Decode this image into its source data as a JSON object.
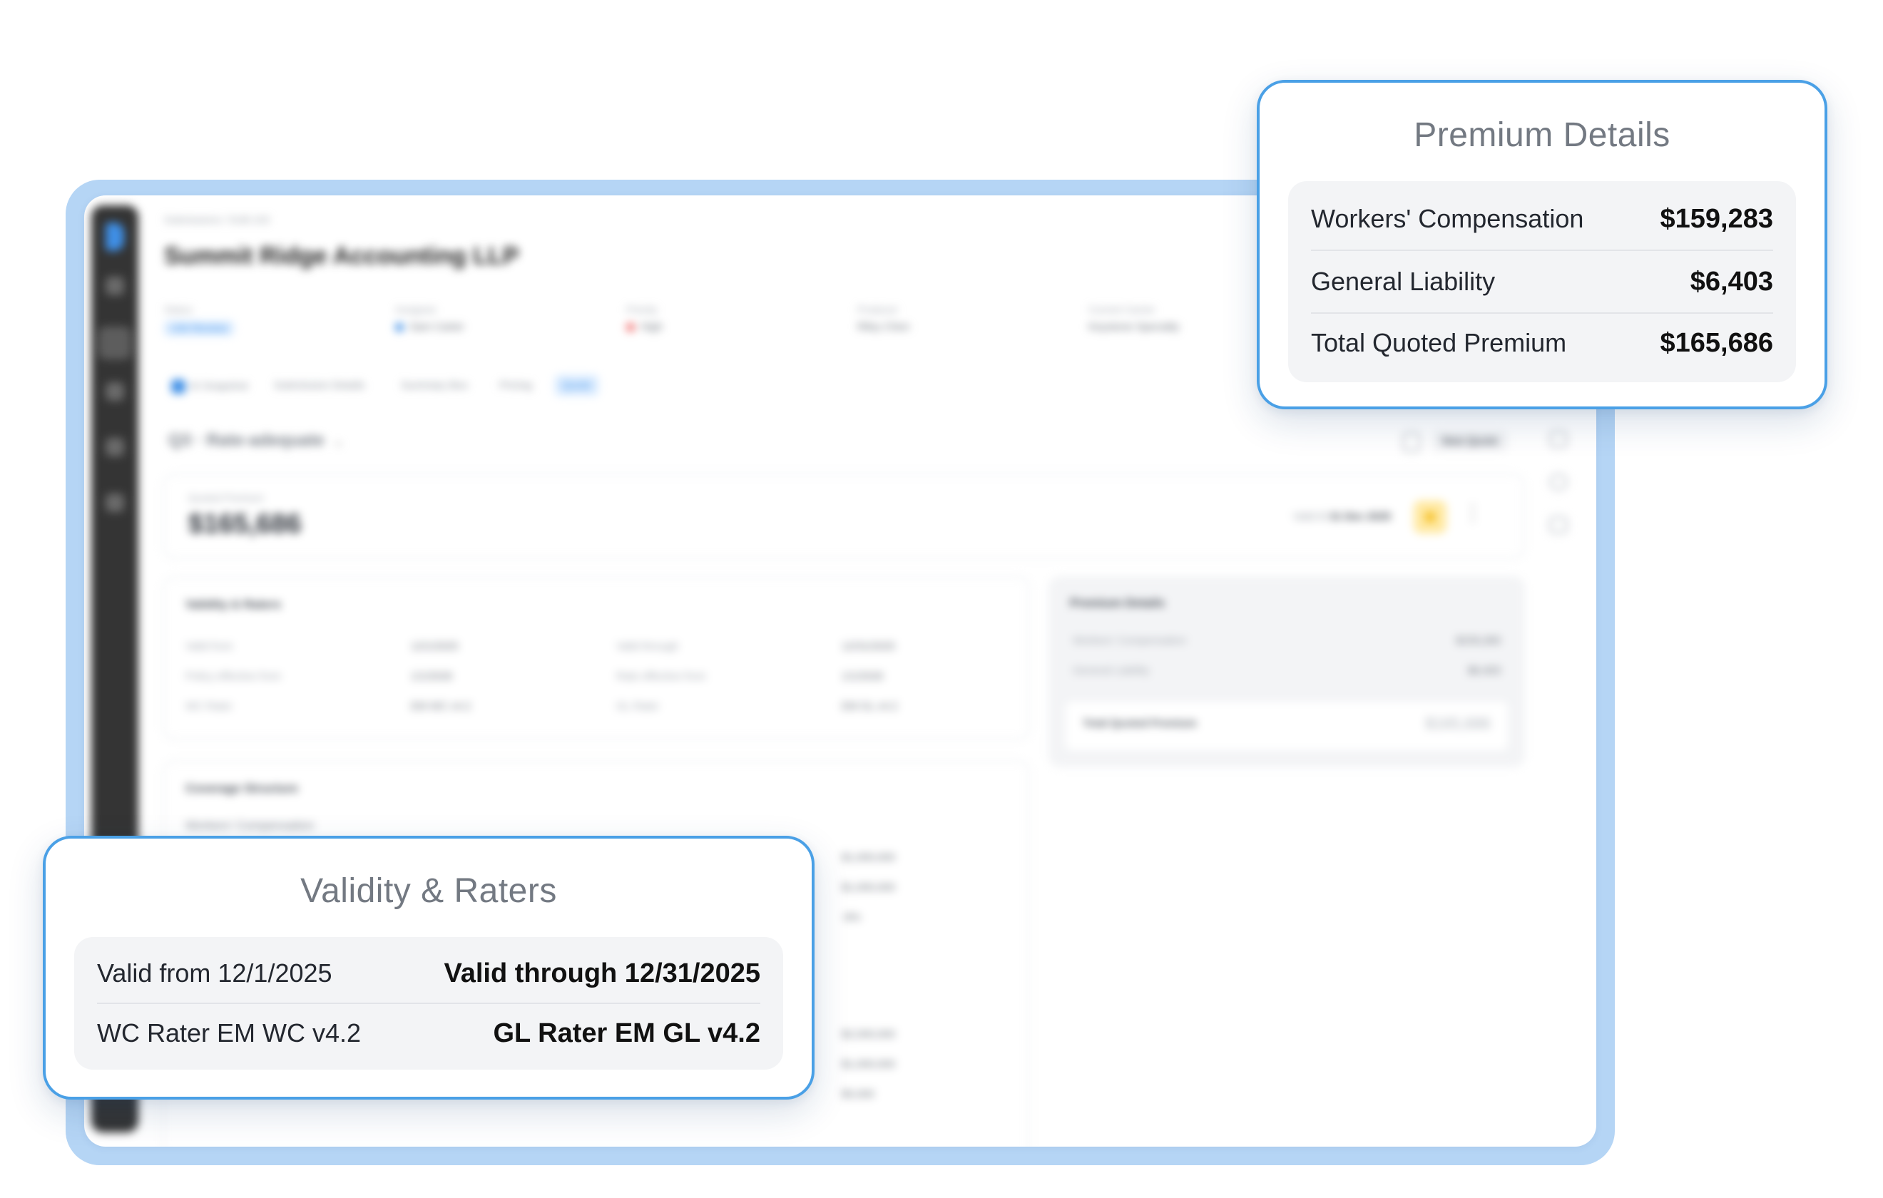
{
  "app": {
    "breadcrumb": "Submissions / SUB-103",
    "company_name": "Summit Ridge Accounting LLP",
    "meta": [
      {
        "label": "Status",
        "value": "UW Review"
      },
      {
        "label": "Assignee",
        "value": "Sam Carter"
      },
      {
        "label": "Priority",
        "value": "High"
      },
      {
        "label": "Producer",
        "value": "Riley Chen"
      },
      {
        "label": "Current Carrier",
        "value": "Keystone Specialty"
      }
    ],
    "tabs": [
      "AI Snapshot",
      "Submission Details",
      "Summary Box",
      "Pricing",
      "Quote"
    ],
    "active_tab": "Quote",
    "quote_selector": "Q3 · Rate-adequate",
    "new_quote_label": "New Quote",
    "quoted_premium": {
      "label": "Quoted Premium",
      "value": "$165,686",
      "valid_label": "Valid til",
      "valid_date": "31 Dec 2025"
    },
    "validity_section": {
      "title": "Validity & Raters",
      "rows": [
        [
          "Valid from",
          "12/1/2025",
          "Valid through",
          "12/31/2025"
        ],
        [
          "Policy effective from",
          "1/1/2026",
          "Rate effective from",
          "1/1/2026"
        ],
        [
          "WC Rater",
          "EM WC v4.2",
          "GL Rater",
          "EM GL v4.2"
        ]
      ]
    },
    "coverage_section": {
      "title": "Coverage Structure",
      "subtitle": "Workers' Compensation",
      "values": [
        "$1,000,000",
        "$1,000,000",
        "-8%",
        "$2,000,000",
        "$1,000,000",
        "$5,000"
      ]
    },
    "premium_section": {
      "title": "Premium Details",
      "rows": [
        {
          "label": "Workers' Compensation",
          "value": "$159,283"
        },
        {
          "label": "General Liability",
          "value": "$6,403"
        }
      ],
      "total_label": "Total Quoted Premium",
      "total_value": "$165,686"
    }
  },
  "callout_premium": {
    "title": "Premium Details",
    "rows": [
      {
        "label": "Workers' Compensation",
        "value": "$159,283"
      },
      {
        "label": "General Liability",
        "value": "$6,403"
      },
      {
        "label": "Total Quoted Premium",
        "value": "$165,686"
      }
    ]
  },
  "callout_validity": {
    "title": "Validity & Raters",
    "rows": [
      {
        "left": "Valid from 12/1/2025",
        "right": "Valid through 12/31/2025"
      },
      {
        "left": "WC Rater EM WC v4.2",
        "right": "GL Rater EM GL v4.2"
      }
    ]
  },
  "colors": {
    "accent": "#4aa0e6",
    "frame": "#b5d5f5",
    "sidebar": "#343434",
    "panel": "#f3f4f6"
  },
  "icons": [
    "logo-icon",
    "home-icon",
    "document-icon",
    "inbox-icon",
    "clock-icon",
    "gear-icon",
    "copy-icon",
    "star-icon",
    "more-icon",
    "mail-icon",
    "chat-icon",
    "calendar-icon",
    "chevron-down-icon",
    "ai-sparkle-icon"
  ]
}
